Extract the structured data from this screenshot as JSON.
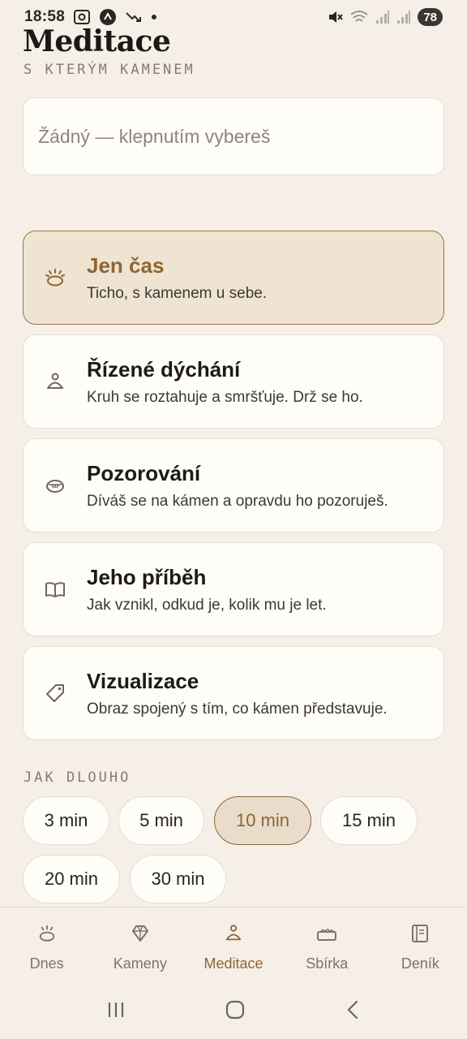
{
  "status_bar": {
    "time": "18:58",
    "battery": "78"
  },
  "header": {
    "title": "Meditace",
    "subtitle": "S KTERÝM KAMENEM"
  },
  "stone_select": {
    "placeholder": "Žádný — klepnutím vybereš"
  },
  "modes": [
    {
      "title": "Jen čas",
      "desc": "Ticho, s kamenem u sebe.",
      "icon": "sun-stone-icon",
      "selected": true
    },
    {
      "title": "Řízené dýchání",
      "desc": "Kruh se roztahuje a smršťuje. Drž se ho.",
      "icon": "breathing-person-icon",
      "selected": false
    },
    {
      "title": "Pozorování",
      "desc": "Díváš se na kámen a opravdu ho pozoruješ.",
      "icon": "eye-stone-icon",
      "selected": false
    },
    {
      "title": "Jeho příběh",
      "desc": "Jak vznikl, odkud je, kolik mu je let.",
      "icon": "open-book-icon",
      "selected": false
    },
    {
      "title": "Vizualizace",
      "desc": "Obraz spojený s tím, co kámen představuje.",
      "icon": "tag-icon",
      "selected": false
    }
  ],
  "duration": {
    "label": "JAK DLOUHO",
    "options": [
      "3 min",
      "5 min",
      "10 min",
      "15 min",
      "20 min",
      "30 min"
    ],
    "selected": "10 min"
  },
  "bottom_nav": [
    {
      "label": "Dnes",
      "icon": "sunrise-icon",
      "active": false
    },
    {
      "label": "Kameny",
      "icon": "gem-icon",
      "active": false
    },
    {
      "label": "Meditace",
      "icon": "meditation-icon",
      "active": true
    },
    {
      "label": "Sbírka",
      "icon": "collection-tray-icon",
      "active": false
    },
    {
      "label": "Deník",
      "icon": "journal-icon",
      "active": false
    }
  ],
  "colors": {
    "background": "#f5efe8",
    "accent": "#8f6534",
    "card": "#fffdf8"
  }
}
